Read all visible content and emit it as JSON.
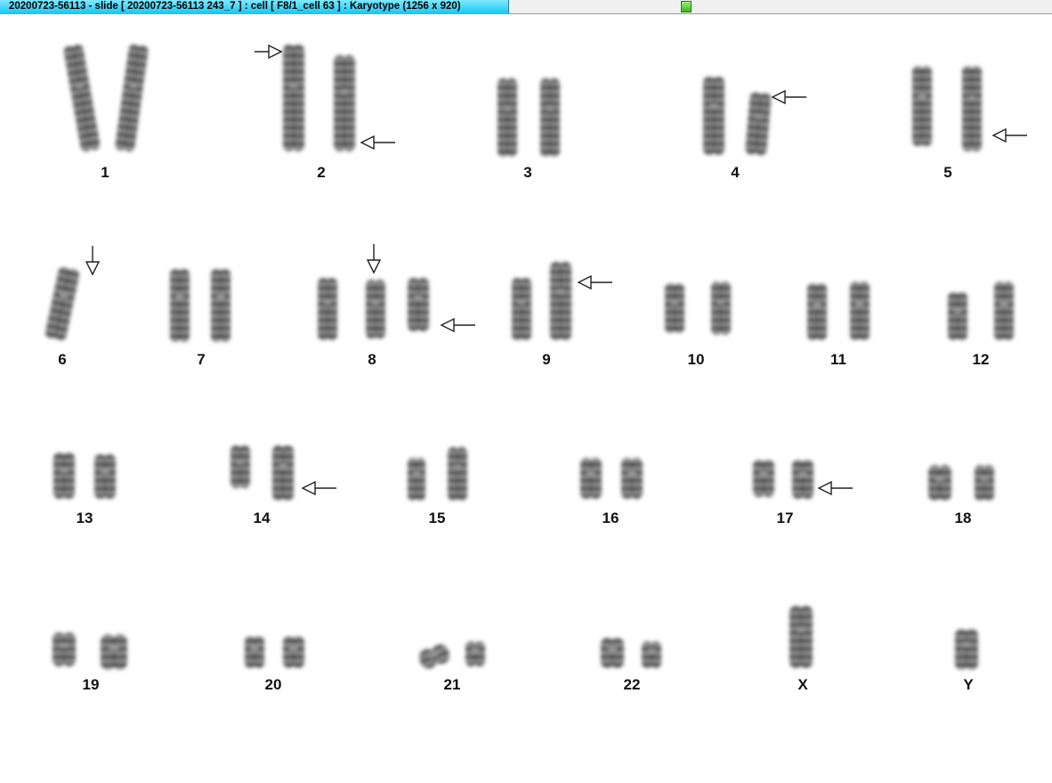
{
  "window": {
    "title": "20200723-56113 - slide [ 20200723-56113 243_7 ] : cell [ F8/1_cell 63 ] : Karyotype  (1256 x 920)",
    "accent_color": "#18c8f2",
    "indicator_color": "#33b81a"
  },
  "karyotype": {
    "chromosomes": [
      {
        "label": "1"
      },
      {
        "label": "2"
      },
      {
        "label": "3"
      },
      {
        "label": "4"
      },
      {
        "label": "5"
      },
      {
        "label": "6"
      },
      {
        "label": "7"
      },
      {
        "label": "8"
      },
      {
        "label": "9"
      },
      {
        "label": "10"
      },
      {
        "label": "11"
      },
      {
        "label": "12"
      },
      {
        "label": "13"
      },
      {
        "label": "14"
      },
      {
        "label": "15"
      },
      {
        "label": "16"
      },
      {
        "label": "17"
      },
      {
        "label": "18"
      },
      {
        "label": "19"
      },
      {
        "label": "20"
      },
      {
        "label": "21"
      },
      {
        "label": "22"
      },
      {
        "label": "X"
      },
      {
        "label": "Y"
      }
    ],
    "arrow_icon": "hollow-arrow-icon"
  }
}
